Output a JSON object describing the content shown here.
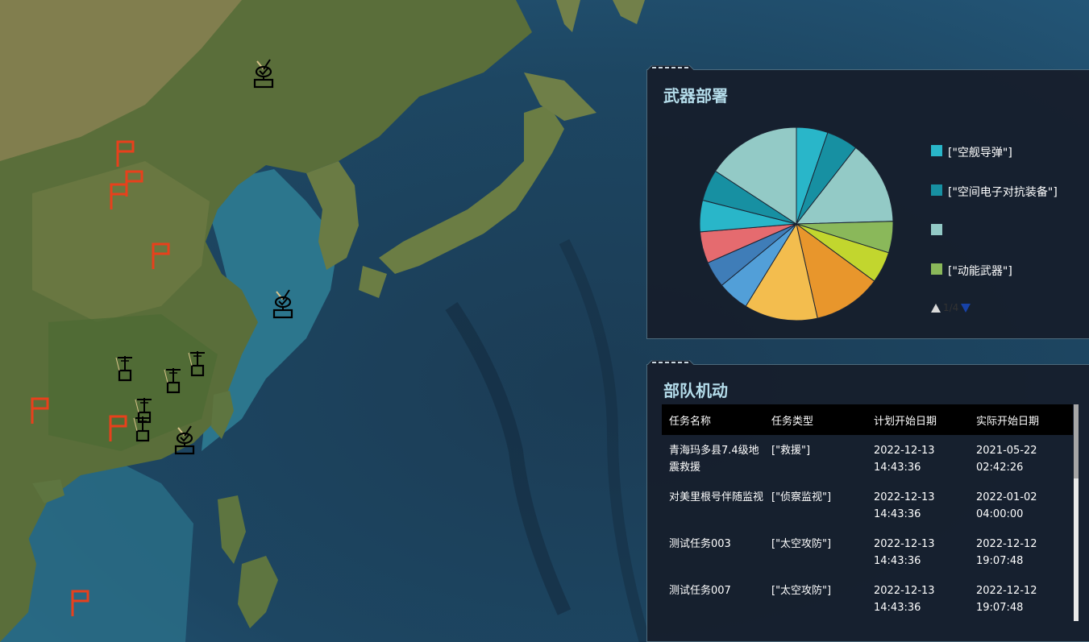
{
  "weapon_panel": {
    "title": "武器部署",
    "legend": [
      {
        "label": "[\"空舰导弹\"]",
        "color": "#29b6c9"
      },
      {
        "label": "[\"空间电子对抗装备\"]",
        "color": "#1790a2"
      },
      {
        "label": "",
        "color": "#93cac6"
      },
      {
        "label": "[\"动能武器\"]",
        "color": "#8ab85a"
      }
    ],
    "pager": "1/4"
  },
  "chart_data": {
    "type": "pie",
    "values": [
      6,
      6,
      16,
      6,
      6,
      13,
      14,
      6,
      5,
      6,
      6,
      6,
      18
    ],
    "colors": [
      "#29b6c9",
      "#1790a2",
      "#93cac6",
      "#8ab85a",
      "#c2d62e",
      "#e8962c",
      "#f3bd4e",
      "#529fd8",
      "#3f7db8",
      "#e56b6f",
      "#29b6c9",
      "#1790a2",
      "#93cac6"
    ],
    "legend_placement": "right"
  },
  "troop_panel": {
    "title": "部队机动",
    "columns": [
      "任务名称",
      "任务类型",
      "计划开始日期",
      "实际开始日期"
    ],
    "rows": [
      [
        "青海玛多县7.4级地震救援",
        "[\"救援\"]",
        "2022-12-13 14:43:36",
        "2021-05-22 02:42:26"
      ],
      [
        "对美里根号伴随监视",
        "[\"侦察监视\"]",
        "2022-12-13 14:43:36",
        "2022-01-02 04:00:00"
      ],
      [
        "测试任务003",
        "[\"太空攻防\"]",
        "2022-12-13 14:43:36",
        "2022-12-12 19:07:48"
      ],
      [
        "测试任务007",
        "[\"太空攻防\"]",
        "2022-12-13 14:43:36",
        "2022-12-12 19:07:48"
      ]
    ]
  },
  "map": {
    "markers": [
      {
        "icon": "radar-icon"
      },
      {
        "icon": "radar-icon"
      },
      {
        "icon": "radar-icon"
      },
      {
        "icon": "flag-icon"
      },
      {
        "icon": "flag-icon"
      },
      {
        "icon": "flag-icon"
      },
      {
        "icon": "flag-icon"
      },
      {
        "icon": "flag-icon"
      },
      {
        "icon": "flag-icon"
      },
      {
        "icon": "flag-icon"
      },
      {
        "icon": "antenna-tower-icon"
      },
      {
        "icon": "antenna-tower-icon"
      },
      {
        "icon": "antenna-tower-icon"
      },
      {
        "icon": "antenna-tower-icon"
      },
      {
        "icon": "antenna-tower-icon"
      }
    ],
    "flag_color": "#e8401c"
  }
}
